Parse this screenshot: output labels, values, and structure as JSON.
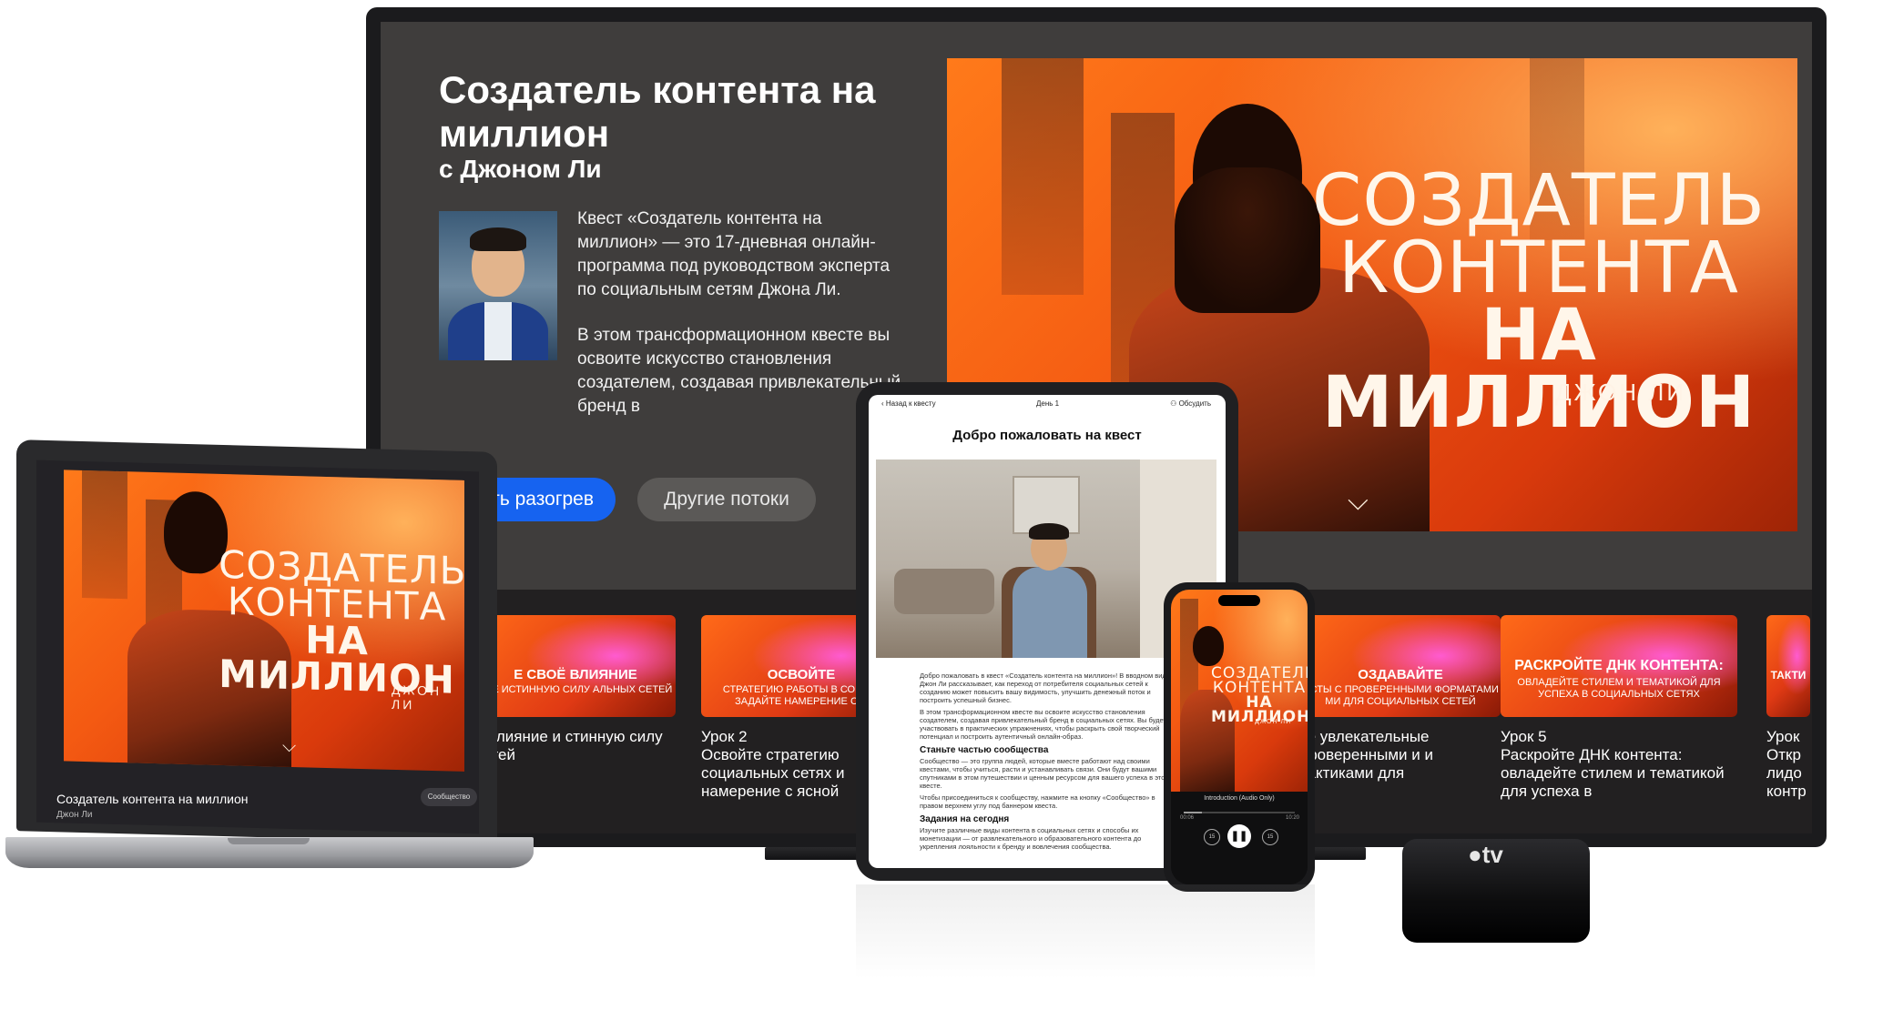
{
  "course": {
    "title": "Создатель контента на миллион",
    "author_line": "с Джоном Ли",
    "description_1": "Квест «Создатель контента на миллион» — это 17-дневная онлайн-программа под руководством эксперта по социальным сетям Джона Ли.",
    "description_2": "В этом трансформационном квесте вы освоите искусство становления создателем, создавая привлекательный бренд в",
    "warmup_button": "ать разогрев",
    "streams_button": "Другие потоки"
  },
  "poster": {
    "line1": "СОЗДАТЕЛЬ",
    "line2": "КОНТЕНТА",
    "line3": "НА МИЛЛИОН",
    "author": "ДЖОН ЛИ",
    "logo_icon": "brand-chevron-icon"
  },
  "lessons": [
    {
      "thumb_title": "Е СВОЁ ВЛИЯНИЕ",
      "thumb_sub": "ЙТЕ ИСТИННУЮ СИЛУ АЛЬНЫХ СЕТЕЙ",
      "number": "",
      "name": "е влияние и стинную силу сетей"
    },
    {
      "thumb_title": "ОСВОЙТЕ",
      "thumb_sub": "СТРАТЕГИЮ РАБОТЫ В СОЦИ И ЗАДАЙТЕ НАМЕРЕНИЕ С Я",
      "number": "Урок 2",
      "name": "Освойте стратегию социальных сетях и намерение с ясной"
    },
    {
      "thumb_title": "ОЗДАВАЙТЕ",
      "thumb_sub": "ОСТЫ С ПРОВЕРЕННЫМИ ФОРМАТАМИ МИ ДЛЯ СОЦИАЛЬНЫХ СЕТЕЙ",
      "number": "",
      "name": "те увлекательные проверенными и и тактиками для"
    },
    {
      "thumb_title": "РАСКРОЙТЕ ДНК КОНТЕНТА:",
      "thumb_sub": "ОВЛАДЕЙТЕ СТИЛЕМ И ТЕМАТИКОЙ ДЛЯ УСПЕХА В СОЦИАЛЬНЫХ СЕТЯХ",
      "number": "Урок 5",
      "name": "Раскройте ДНК контента: овладейте стилем и тематикой для успеха в"
    },
    {
      "thumb_title": "ТАКТИ",
      "thumb_sub": "",
      "number": "Урок",
      "name": "Откр лидо контр"
    }
  ],
  "laptop": {
    "caption": "Создатель контента на миллион",
    "sub": "Джон Ли",
    "community": "Сообщество"
  },
  "tablet": {
    "back": "Назад к квесту",
    "day": "День 1",
    "discuss": "Обсудить",
    "heading": "Добро пожаловать на квест",
    "p1": "Добро пожаловать в квест «Создатель контента на миллион»! В вводном видео Джон Ли рассказывает, как переход от потребителя социальных сетей к созданию может повысить вашу видимость, улучшить денежный поток и построить успешный бизнес.",
    "p2": "В этом трансформационном квесте вы освоите искусство становления создателем, создавая привлекательный бренд в социальных сетях. Вы будете участвовать в практических упражнениях, чтобы раскрыть свой творческий потенциал и построить аутентичный онлайн-образ.",
    "h2": "Станьте частью сообщества",
    "p3": "Сообщество — это группа людей, которые вместе работают над своими квестами, чтобы учиться, расти и устанавливать связи. Они будут вашими спутниками в этом путешествии и ценным ресурсом для вашего успеха в этом квесте.",
    "p4": "Чтобы присоединиться к сообществу, нажмите на кнопку «Сообщество» в правом верхнем углу под баннером квеста.",
    "h3": "Задания на сегодня",
    "p5": "Изучите различные виды контента в социальных сетях и способы их монетизации — от развлекательного и образовательного контента до укрепления лояльности к бренду и вовлечения сообщества."
  },
  "phone": {
    "track": "Introduction (Audio Only)",
    "time_start": "00:06",
    "time_end": "10:20",
    "progress": 0.16
  },
  "appletv": {
    "logo": "tv"
  }
}
